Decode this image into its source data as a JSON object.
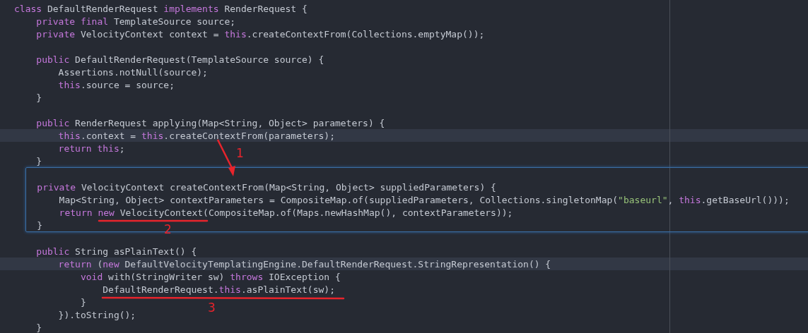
{
  "editor": {
    "blocks": [
      {
        "boxed": false,
        "lines": [
          {
            "highlighted": false,
            "tokens": [
              {
                "kind": "keyword",
                "text": "class"
              },
              {
                "kind": "plain",
                "text": " DefaultRenderRequest "
              },
              {
                "kind": "keyword",
                "text": "implements"
              },
              {
                "kind": "plain",
                "text": " RenderRequest {"
              }
            ]
          },
          {
            "highlighted": false,
            "tokens": [
              {
                "kind": "keyword",
                "text": "    private final"
              },
              {
                "kind": "plain",
                "text": " TemplateSource source;"
              }
            ]
          },
          {
            "highlighted": false,
            "tokens": [
              {
                "kind": "keyword",
                "text": "    private"
              },
              {
                "kind": "plain",
                "text": " VelocityContext context = "
              },
              {
                "kind": "keyword",
                "text": "this"
              },
              {
                "kind": "plain",
                "text": ".createContextFrom(Collections.emptyMap());"
              }
            ]
          },
          {
            "highlighted": false
          },
          {
            "highlighted": false,
            "tokens": [
              {
                "kind": "keyword",
                "text": "    public"
              },
              {
                "kind": "plain",
                "text": " DefaultRenderRequest(TemplateSource source) {"
              }
            ]
          },
          {
            "highlighted": false,
            "tokens": [
              {
                "kind": "plain",
                "text": "        Assertions.notNull(source);"
              }
            ]
          },
          {
            "highlighted": false,
            "tokens": [
              {
                "kind": "keyword",
                "text": "        this"
              },
              {
                "kind": "plain",
                "text": ".source = source;"
              }
            ]
          },
          {
            "highlighted": false,
            "tokens": [
              {
                "kind": "plain",
                "text": "    }"
              }
            ]
          },
          {
            "highlighted": false
          },
          {
            "highlighted": false,
            "tokens": [
              {
                "kind": "keyword",
                "text": "    public"
              },
              {
                "kind": "plain",
                "text": " RenderRequest applying(Map<String, Object> parameters) {"
              }
            ]
          },
          {
            "highlighted": true,
            "tokens": [
              {
                "kind": "keyword",
                "text": "        this"
              },
              {
                "kind": "plain",
                "text": ".context = "
              },
              {
                "kind": "keyword",
                "text": "this"
              },
              {
                "kind": "plain",
                "text": ".createContextFrom(parameters);"
              }
            ]
          },
          {
            "highlighted": false,
            "tokens": [
              {
                "kind": "keyword",
                "text": "        return this"
              },
              {
                "kind": "plain",
                "text": ";"
              }
            ]
          },
          {
            "highlighted": false,
            "tokens": [
              {
                "kind": "plain",
                "text": "    }"
              }
            ]
          }
        ]
      },
      {
        "boxed": true,
        "lines": [
          {
            "highlighted": false
          },
          {
            "highlighted": false,
            "tokens": [
              {
                "kind": "keyword",
                "text": "    private"
              },
              {
                "kind": "plain",
                "text": " VelocityContext createContextFrom(Map<String, Object> suppliedParameters) {"
              }
            ]
          },
          {
            "highlighted": false,
            "tokens": [
              {
                "kind": "plain",
                "text": "        Map<String, Object> contextParameters = CompositeMap.of(suppliedParameters, Collections.singletonMap("
              },
              {
                "kind": "string",
                "text": "\"baseurl\""
              },
              {
                "kind": "plain",
                "text": ", "
              },
              {
                "kind": "keyword",
                "text": "this"
              },
              {
                "kind": "plain",
                "text": ".getBaseUrl()));"
              }
            ]
          },
          {
            "highlighted": false,
            "tokens": [
              {
                "kind": "keyword",
                "text": "        return new"
              },
              {
                "kind": "plain",
                "text": " VelocityContext(CompositeMap.of(Maps.newHashMap(), contextParameters));"
              }
            ]
          },
          {
            "highlighted": false,
            "tokens": [
              {
                "kind": "plain",
                "text": "    }"
              }
            ]
          }
        ]
      },
      {
        "boxed": false,
        "lines": [
          {
            "highlighted": false
          },
          {
            "highlighted": false,
            "tokens": [
              {
                "kind": "keyword",
                "text": "    public"
              },
              {
                "kind": "plain",
                "text": " String asPlainText() {"
              }
            ]
          },
          {
            "highlighted": true,
            "tokens": [
              {
                "kind": "keyword",
                "text": "        return"
              },
              {
                "kind": "plain",
                "text": " ("
              },
              {
                "kind": "keyword",
                "text": "new"
              },
              {
                "kind": "plain",
                "text": " DefaultVelocityTemplatingEngine.DefaultRenderRequest.StringRepresentation() {"
              }
            ]
          },
          {
            "highlighted": false,
            "tokens": [
              {
                "kind": "keyword",
                "text": "            void"
              },
              {
                "kind": "plain",
                "text": " with(StringWriter sw) "
              },
              {
                "kind": "keyword",
                "text": "throws"
              },
              {
                "kind": "plain",
                "text": " IOException {"
              }
            ]
          },
          {
            "highlighted": false,
            "tokens": [
              {
                "kind": "plain",
                "text": "                DefaultRenderRequest."
              },
              {
                "kind": "keyword",
                "text": "this"
              },
              {
                "kind": "plain",
                "text": ".asPlainText(sw);"
              }
            ]
          },
          {
            "highlighted": false,
            "tokens": [
              {
                "kind": "plain",
                "text": "            }"
              }
            ]
          },
          {
            "highlighted": false,
            "tokens": [
              {
                "kind": "plain",
                "text": "        }).toString();"
              }
            ]
          },
          {
            "highlighted": false,
            "tokens": [
              {
                "kind": "plain",
                "text": "    }"
              }
            ]
          }
        ]
      }
    ]
  },
  "annotations": [
    {
      "kind": "arrow",
      "label": "1"
    },
    {
      "kind": "underline",
      "label": "2"
    },
    {
      "kind": "underline",
      "label": "3"
    }
  ]
}
